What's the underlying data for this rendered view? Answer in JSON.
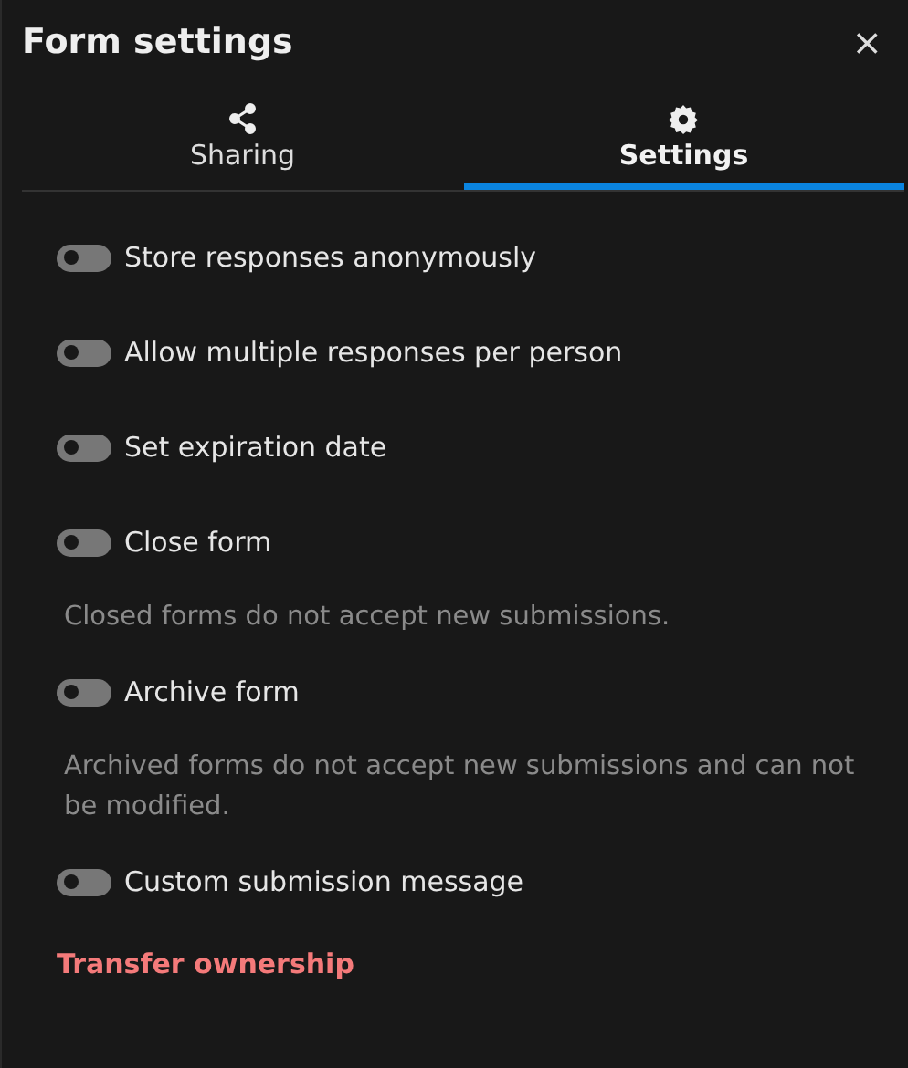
{
  "title": "Form settings",
  "close": "×",
  "tabs": [
    {
      "label": "Sharing",
      "kind": "share",
      "selected": false
    },
    {
      "label": "Settings",
      "kind": "gear",
      "selected": true
    }
  ],
  "settings": [
    {
      "label": "Store responses anonymously",
      "on": false
    },
    {
      "label": "Allow multiple responses per person",
      "on": false
    },
    {
      "label": "Set expiration date",
      "on": false
    },
    {
      "label": "Close form",
      "on": false,
      "description": "Closed forms do not accept new submissions."
    },
    {
      "label": "Archive form",
      "on": false,
      "description": "Archived forms do not accept new submissions and can not be modified."
    },
    {
      "label": "Custom submission message",
      "on": false
    }
  ],
  "transfer_link": "Transfer ownership"
}
